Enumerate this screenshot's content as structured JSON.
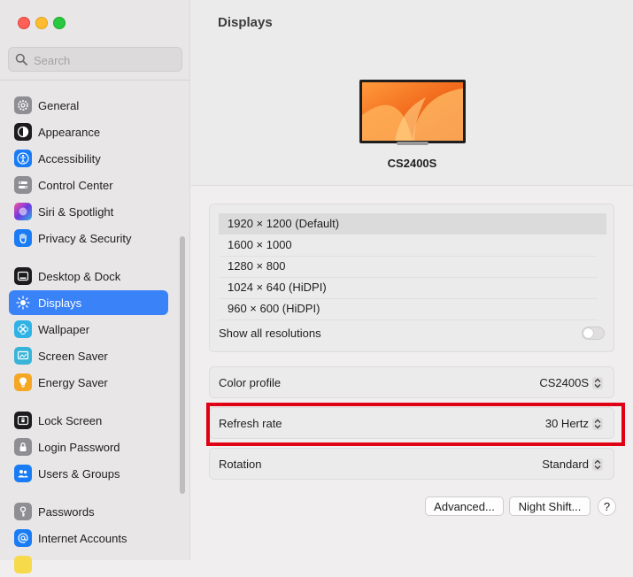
{
  "search": {
    "placeholder": "Search"
  },
  "sidebar": {
    "items": [
      {
        "label": "General",
        "icon": "gear-icon",
        "color": "#8e8e93"
      },
      {
        "label": "Appearance",
        "icon": "appearance-icon",
        "color": "#1c1c1e"
      },
      {
        "label": "Accessibility",
        "icon": "accessibility-icon",
        "color": "#1a7cf5"
      },
      {
        "label": "Control Center",
        "icon": "control-center-icon",
        "color": "#8e8e93"
      },
      {
        "label": "Siri & Spotlight",
        "icon": "siri-icon",
        "color": "#6b3ae0"
      },
      {
        "label": "Privacy & Security",
        "icon": "hand-icon",
        "color": "#1a7cf5"
      },
      {
        "label": "Desktop & Dock",
        "icon": "dock-icon",
        "color": "#1c1c1e"
      },
      {
        "label": "Displays",
        "icon": "sun-icon",
        "color": "#1a7cf5"
      },
      {
        "label": "Wallpaper",
        "icon": "wallpaper-icon",
        "color": "#2fb2e6"
      },
      {
        "label": "Screen Saver",
        "icon": "screen-saver-icon",
        "color": "#38b4d8"
      },
      {
        "label": "Energy Saver",
        "icon": "bulb-icon",
        "color": "#f5a623"
      },
      {
        "label": "Lock Screen",
        "icon": "lock-screen-icon",
        "color": "#1c1c1e"
      },
      {
        "label": "Login Password",
        "icon": "lock-icon",
        "color": "#8e8e93"
      },
      {
        "label": "Users & Groups",
        "icon": "users-icon",
        "color": "#1a7cf5"
      },
      {
        "label": "Passwords",
        "icon": "key-icon",
        "color": "#8e8e93"
      },
      {
        "label": "Internet Accounts",
        "icon": "at-icon",
        "color": "#1a7cf5"
      }
    ]
  },
  "main": {
    "title": "Displays",
    "display_name": "CS2400S",
    "resolutions": [
      "1920 × 1200 (Default)",
      "1600 × 1000",
      "1280 × 800",
      "1024 × 640 (HiDPI)",
      "960 × 600 (HiDPI)"
    ],
    "show_all_label": "Show all resolutions",
    "color_profile": {
      "label": "Color profile",
      "value": "CS2400S"
    },
    "refresh_rate": {
      "label": "Refresh rate",
      "value": "30 Hertz"
    },
    "rotation": {
      "label": "Rotation",
      "value": "Standard"
    },
    "buttons": {
      "advanced": "Advanced...",
      "night_shift": "Night Shift...",
      "help": "?"
    }
  },
  "colors": {
    "accent": "#3a82f7",
    "highlight": "#e00014"
  }
}
